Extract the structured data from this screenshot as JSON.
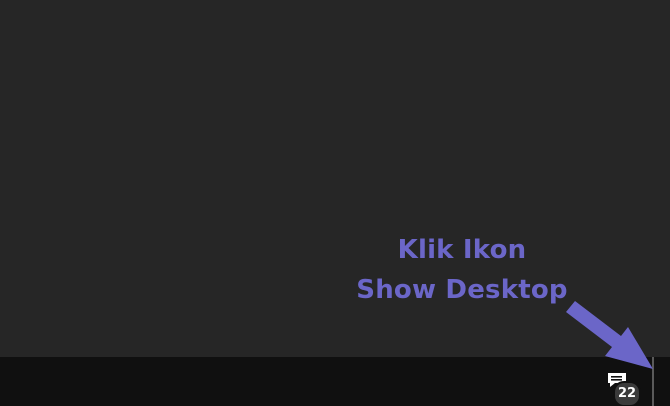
{
  "annotation": {
    "line1": "Klik Ikon",
    "line2": "Show Desktop",
    "color": "#6b66c8"
  },
  "taskbar": {
    "notification_count": "22",
    "action_center_icon": "message-icon",
    "show_desktop_button": "show-desktop-button"
  },
  "colors": {
    "desktop": "#262626",
    "taskbar": "#101010",
    "badge": "#3b3b3b",
    "arrow": "#6b66c8"
  }
}
